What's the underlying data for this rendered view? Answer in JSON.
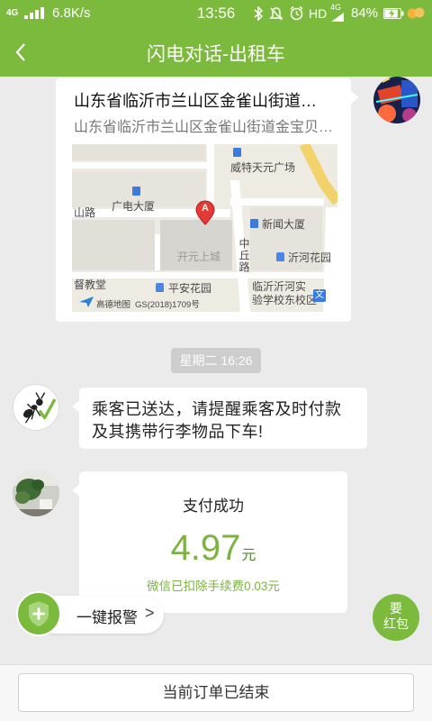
{
  "status_bar": {
    "network_type_left": "4G",
    "net_speed": "6.8K/s",
    "time": "13:56",
    "hd_label": "HD",
    "network_type_right": "4G",
    "battery_percent": "84%",
    "battery_level": 0.84
  },
  "header": {
    "back_icon": "chevron-left-icon",
    "title": "闪电对话-出租车"
  },
  "chat": {
    "location_message": {
      "title": "山东省临沂市兰山区金雀山街道…",
      "address": "山东省临沂市兰山区金雀山街道金宝贝…",
      "map": {
        "labels": [
          "威特天元广场",
          "广电大厦",
          "新闻大厦",
          "开元上城",
          "中丘路",
          "沂河花园",
          "督教堂",
          "平安花园",
          "临沂沂河实",
          "验学校东校区",
          "山路"
        ],
        "school_glyph": "文",
        "pin_letter": "A",
        "provider": "高德地图",
        "license": "GS(2018)1709号"
      }
    },
    "timestamp": "星期二 16:26",
    "arrival_notice": {
      "lines": [
        "乘客已送达，请提醒乘客及时付款",
        "及其携带行李物品下车!"
      ]
    },
    "payment": {
      "status": "支付成功",
      "amount": "4.97",
      "currency": "元",
      "fee_note": "微信已扣除手续费0.03元"
    }
  },
  "sos_button": {
    "icon": "shield-plus-icon",
    "label": "一键报警",
    "arrow": ">"
  },
  "red_packet_button": {
    "line1": "要",
    "line2": "红包"
  },
  "footer": {
    "order_status_button": "当前订单已结束"
  },
  "colors": {
    "brand_green": "#7cba3e",
    "amount_green": "#7cb342",
    "chat_background": "#ebebeb",
    "timestamp_chip": "#cdcdcd"
  }
}
